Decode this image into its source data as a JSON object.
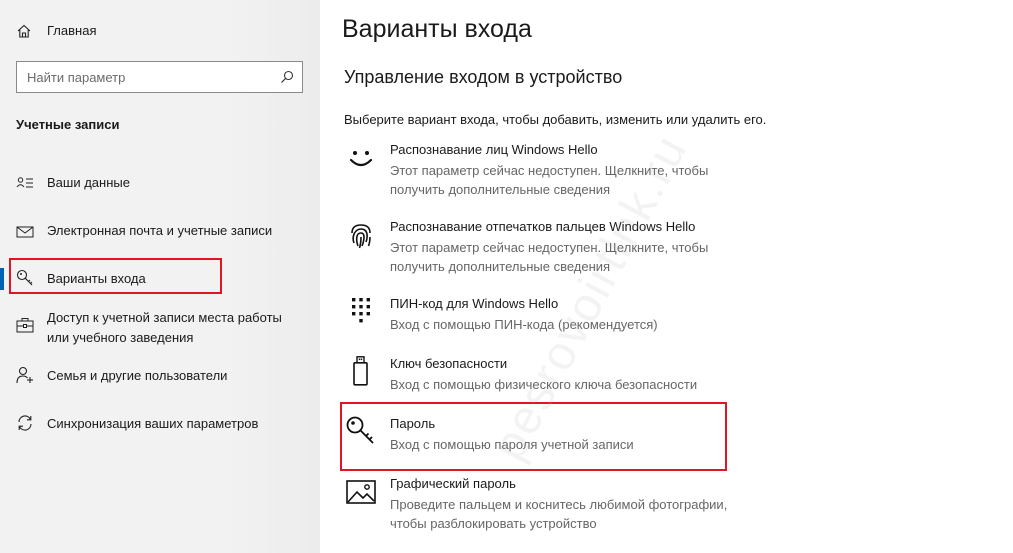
{
  "sidebar": {
    "home": {
      "label": "Главная",
      "icon": "home-icon"
    },
    "search": {
      "placeholder": "Найти параметр",
      "value": ""
    },
    "section_title": "Учетные записи",
    "items": [
      {
        "label": "Ваши данные",
        "icon": "person-card-icon"
      },
      {
        "label": "Электронная почта и учетные записи",
        "icon": "mail-icon"
      },
      {
        "label": "Варианты входа",
        "icon": "key-icon",
        "active": true
      },
      {
        "label_line1": "Доступ к учетной записи места работы",
        "label_line2": "или учебного заведения",
        "icon": "briefcase-icon"
      },
      {
        "label": "Семья и другие пользователи",
        "icon": "person-add-icon"
      },
      {
        "label": "Синхронизация ваших параметров",
        "icon": "sync-icon"
      }
    ]
  },
  "main": {
    "title": "Варианты входа",
    "subtitle": "Управление входом в устройство",
    "instruction": "Выберите вариант входа, чтобы добавить, изменить или удалить его.",
    "options": [
      {
        "title": "Распознавание лиц Windows Hello",
        "desc_line1": "Этот параметр сейчас недоступен. Щелкните, чтобы",
        "desc_line2": "получить дополнительные сведения",
        "icon": "face-icon"
      },
      {
        "title": "Распознавание отпечатков пальцев Windows Hello",
        "desc_line1": "Этот параметр сейчас недоступен. Щелкните, чтобы",
        "desc_line2": "получить дополнительные сведения",
        "icon": "fingerprint-icon"
      },
      {
        "title": "ПИН-код для Windows Hello",
        "desc_line1": "Вход с помощью ПИН-кода (рекомендуется)",
        "icon": "keypad-icon"
      },
      {
        "title": "Ключ безопасности",
        "desc_line1": "Вход с помощью физического ключа безопасности",
        "icon": "usb-key-icon"
      },
      {
        "title": "Пароль",
        "desc_line1": "Вход с помощью пароля учетной записи",
        "icon": "key-icon"
      },
      {
        "title": "Графический пароль",
        "desc_line1": "Проведите пальцем и коснитесь любимой фотографии,",
        "desc_line2": "чтобы разблокировать устройство",
        "icon": "picture-icon"
      }
    ]
  },
  "watermark": "pesrovoirtlnk.ru",
  "colors": {
    "accent": "#0063b1",
    "highlight": "#e01722",
    "sidebar_bg": "#f2f2f2"
  }
}
